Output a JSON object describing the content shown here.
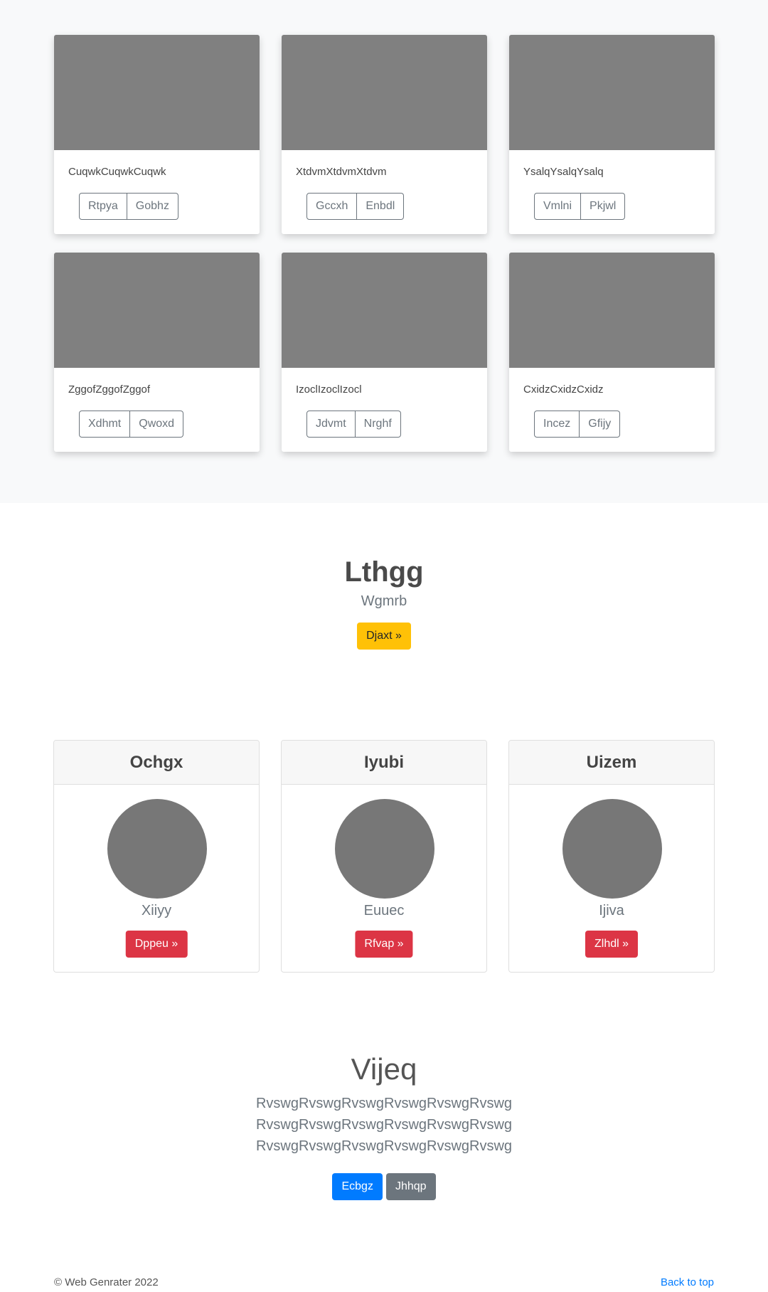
{
  "album": {
    "cards": [
      {
        "text": "CuqwkCuqwkCuqwk",
        "btn1": "Rtpya",
        "btn2": "Gobhz"
      },
      {
        "text": "XtdvmXtdvmXtdvm",
        "btn1": "Gccxh",
        "btn2": "Enbdl"
      },
      {
        "text": "YsalqYsalqYsalq",
        "btn1": "Vmlni",
        "btn2": "Pkjwl"
      },
      {
        "text": "ZggofZggofZggof",
        "btn1": "Xdhmt",
        "btn2": "Qwoxd"
      },
      {
        "text": "IzoclIzoclIzocl",
        "btn1": "Jdvmt",
        "btn2": "Nrghf"
      },
      {
        "text": "CxidzCxidzCxidz",
        "btn1": "Incez",
        "btn2": "Gfijy"
      }
    ]
  },
  "feature": {
    "title": "Lthgg",
    "subtitle": "Wgmrb",
    "button": "Djaxt »"
  },
  "profiles": [
    {
      "header": "Ochgx",
      "name": "Xiiyy",
      "button": "Dppeu »"
    },
    {
      "header": "Iyubi",
      "name": "Euuec",
      "button": "Rfvap »"
    },
    {
      "header": "Uizem",
      "name": "Ijiva",
      "button": "Zlhdl »"
    }
  ],
  "hero": {
    "title": "Vijeq",
    "lines": [
      "RvswgRvswgRvswgRvswgRvswgRvswg",
      "RvswgRvswgRvswgRvswgRvswgRvswg",
      "RvswgRvswgRvswgRvswgRvswgRvswg"
    ],
    "primary": "Ecbgz",
    "secondary": "Jhhqp"
  },
  "footer": {
    "copyright": "© Web Genrater 2022",
    "back_to_top": "Back to top"
  }
}
